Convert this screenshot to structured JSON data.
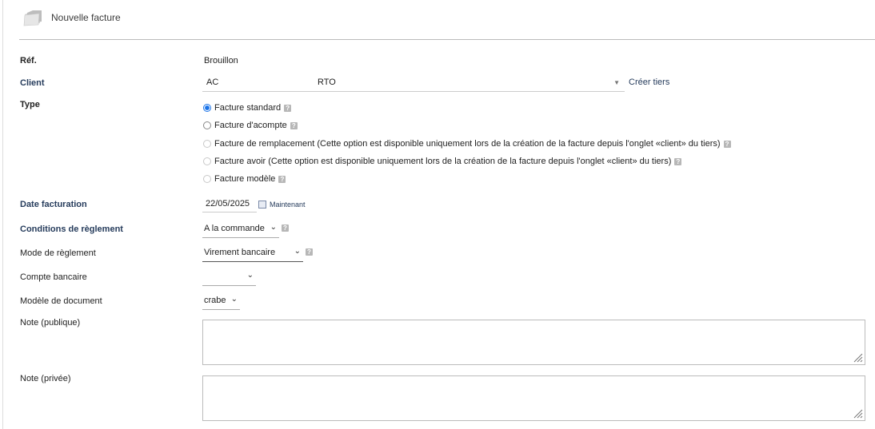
{
  "header": {
    "title": "Nouvelle facture"
  },
  "form": {
    "ref": {
      "label": "Réf.",
      "value": "Brouillon"
    },
    "client": {
      "label": "Client",
      "value_start": "AC",
      "value_end": "RTO",
      "create_link": "Créer tiers"
    },
    "type": {
      "label": "Type",
      "options": [
        {
          "label": "Facture standard",
          "checked": true,
          "disabled": false
        },
        {
          "label": "Facture d'acompte",
          "checked": false,
          "disabled": false
        },
        {
          "label": "Facture de remplacement (Cette option est disponible uniquement lors de la création de la facture depuis l'onglet «client» du tiers)",
          "checked": false,
          "disabled": true
        },
        {
          "label": "Facture avoir (Cette option est disponible uniquement lors de la création de la facture depuis l'onglet «client» du tiers)",
          "checked": false,
          "disabled": true
        },
        {
          "label": "Facture modèle",
          "checked": false,
          "disabled": true
        }
      ]
    },
    "date": {
      "label": "Date facturation",
      "value": "22/05/2025",
      "now_link": "Maintenant"
    },
    "payment_terms": {
      "label": "Conditions de règlement",
      "value": "A la commande"
    },
    "payment_mode": {
      "label": "Mode de règlement",
      "value": "Virement bancaire"
    },
    "bank_account": {
      "label": "Compte bancaire",
      "value": ""
    },
    "doc_model": {
      "label": "Modèle de document",
      "value": "crabe"
    },
    "note_public": {
      "label": "Note (publique)",
      "value": ""
    },
    "note_private": {
      "label": "Note (privée)",
      "value": ""
    }
  },
  "colors": {
    "label_blue": "#263c5c",
    "radio_accent": "#1a73e8"
  },
  "icons": {
    "header": "folder-icon",
    "help": "help-icon",
    "calendar": "calendar-icon",
    "dropdown": "chevron-down-icon",
    "resize": "resize-grip-icon"
  }
}
